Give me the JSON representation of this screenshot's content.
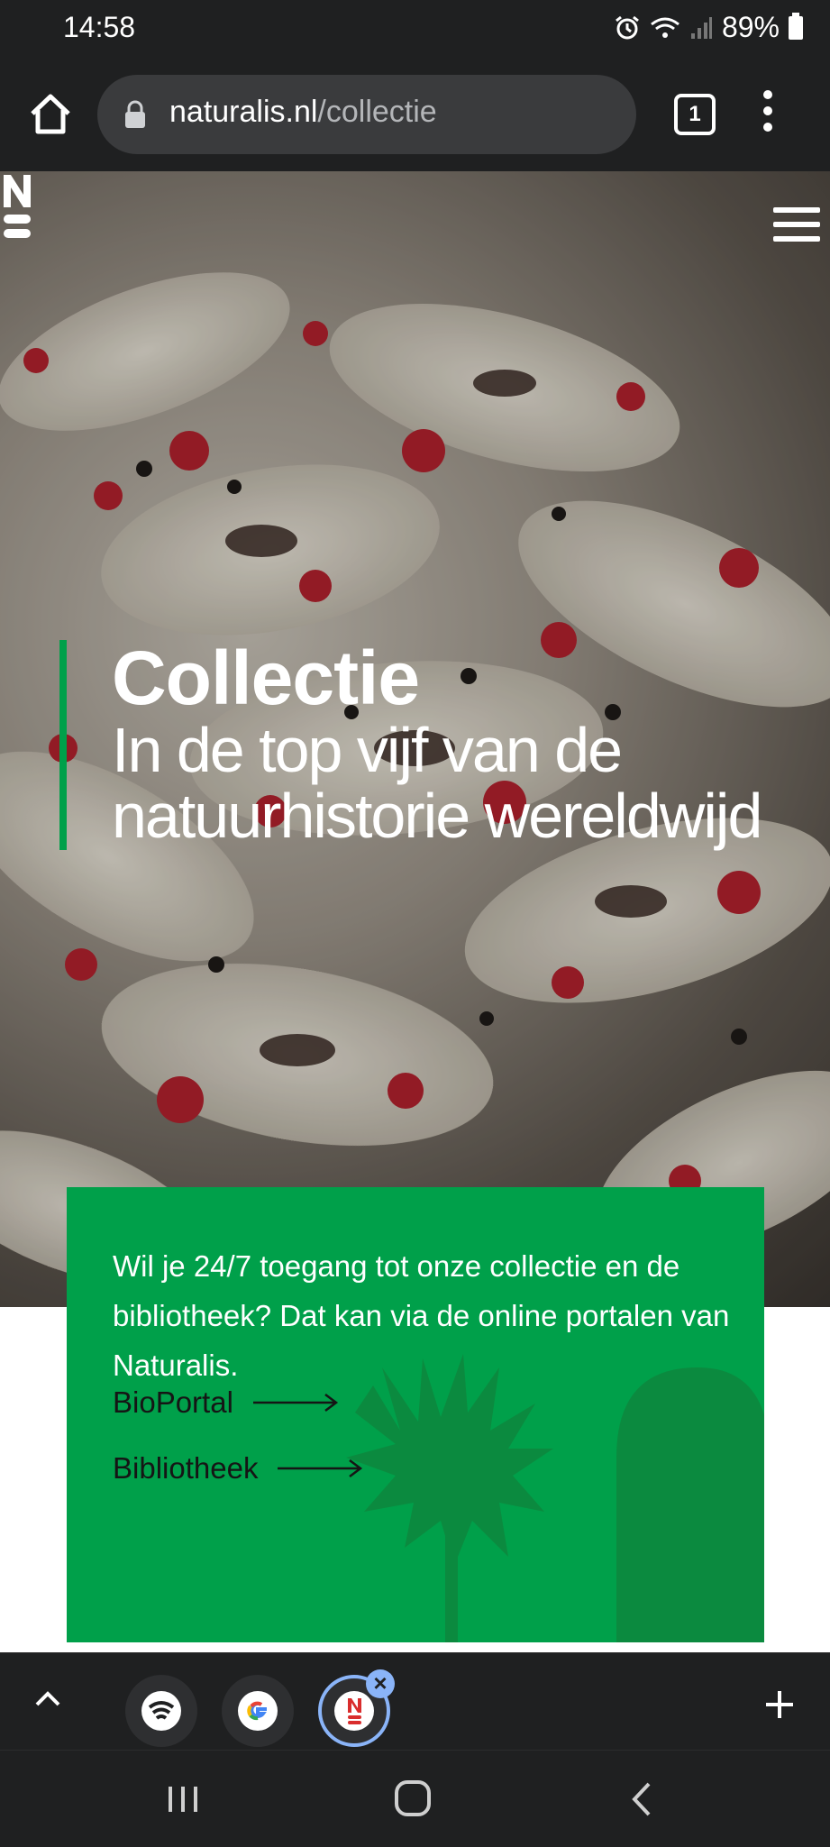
{
  "status_bar": {
    "time": "14:58",
    "battery": "89%",
    "icons": [
      "alarm-icon",
      "wifi-icon",
      "signal-icon",
      "battery-icon"
    ]
  },
  "browser": {
    "url_domain": "naturalis.nl",
    "url_path": "/collectie",
    "tab_count": "1"
  },
  "hero": {
    "title": "Collectie",
    "subtitle": "In de top vijf van de natuurhistorie wereldwijd"
  },
  "card": {
    "text": "Wil je 24/7 toegang tot onze collectie en de bibliotheek? Dat kan via de online portalen van Naturalis.",
    "links": [
      {
        "label": "BioPortal"
      },
      {
        "label": "Bibliotheek"
      }
    ]
  },
  "colors": {
    "accent_green": "#00a04a",
    "browser_dark": "#1f2021",
    "active_tab_ring": "#8ab4f8"
  }
}
